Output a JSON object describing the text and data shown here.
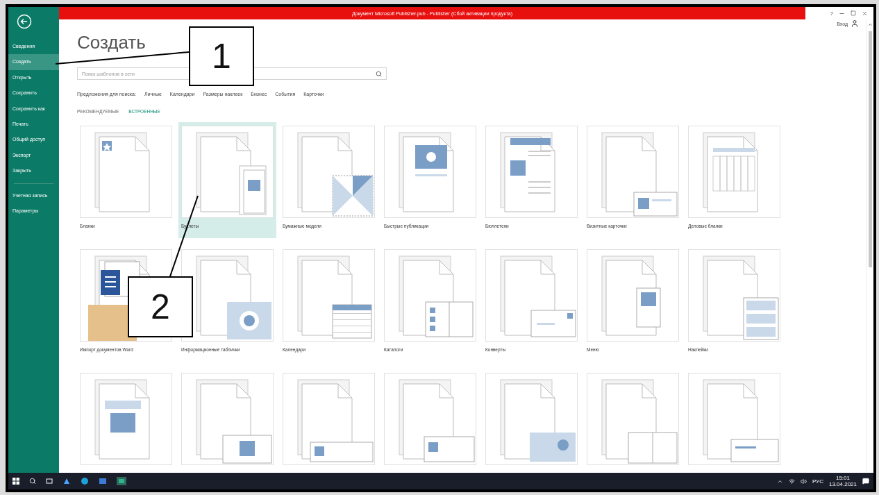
{
  "window": {
    "title": "Документ Microsoft Publisher.pub - Publisher (Сбой активации продукта)",
    "help": "?",
    "sign_in": "Вход"
  },
  "sidebar": {
    "items": [
      {
        "label": "Сведения",
        "selected": false
      },
      {
        "label": "Создать",
        "selected": true
      },
      {
        "label": "Открыть",
        "selected": false
      },
      {
        "label": "Сохранить",
        "selected": false
      },
      {
        "label": "Сохранить как",
        "selected": false
      },
      {
        "label": "Печать",
        "selected": false
      },
      {
        "label": "Общий доступ",
        "selected": false
      },
      {
        "label": "Экспорт",
        "selected": false
      },
      {
        "label": "Закрыть",
        "selected": false
      },
      {
        "label": "Учетная запись",
        "selected": false
      },
      {
        "label": "Параметры",
        "selected": false
      }
    ]
  },
  "page_title": "Создать",
  "search": {
    "placeholder": "Поиск шаблонов в сети"
  },
  "suggestions": {
    "label": "Предложения для поиска:",
    "items": [
      "Личные",
      "Календари",
      "Размеры наклеек",
      "Бизнес",
      "События",
      "Карточки"
    ]
  },
  "tabs": [
    {
      "label": "РЕКОМЕНДУЕМЫЕ",
      "selected": false
    },
    {
      "label": "ВСТРОЕННЫЕ",
      "selected": true
    }
  ],
  "templates": [
    {
      "label": "Бланки",
      "kind": "star",
      "selected": false
    },
    {
      "label": "Буклеты",
      "kind": "brochure",
      "selected": true
    },
    {
      "label": "Бумажные модели",
      "kind": "model",
      "selected": false
    },
    {
      "label": "Быстрые публикации",
      "kind": "quick",
      "selected": false
    },
    {
      "label": "Бюллетени",
      "kind": "newsletter",
      "selected": false
    },
    {
      "label": "Визитные карточки",
      "kind": "bizcard",
      "selected": false
    },
    {
      "label": "Деловые бланки",
      "kind": "form",
      "selected": false
    },
    {
      "label": "Импорт документов Word",
      "kind": "word",
      "selected": false
    },
    {
      "label": "Информационные таблички",
      "kind": "sign",
      "selected": false
    },
    {
      "label": "Календари",
      "kind": "calendar",
      "selected": false
    },
    {
      "label": "Каталоги",
      "kind": "catalog",
      "selected": false
    },
    {
      "label": "Конверты",
      "kind": "envelope",
      "selected": false
    },
    {
      "label": "Меню",
      "kind": "menu",
      "selected": false
    },
    {
      "label": "Наклейки",
      "kind": "labels",
      "selected": false
    },
    {
      "kind": "video",
      "selected": false
    },
    {
      "kind": "heart",
      "selected": false
    },
    {
      "kind": "banner",
      "selected": false
    },
    {
      "kind": "photo",
      "selected": false
    },
    {
      "kind": "circle",
      "selected": false
    },
    {
      "kind": "postcard",
      "selected": false
    },
    {
      "kind": "strip",
      "selected": false
    }
  ],
  "callouts": [
    {
      "label": "1"
    },
    {
      "label": "2"
    }
  ],
  "taskbar": {
    "language": "РУС",
    "time": "15:01",
    "date": "13.04.2021"
  }
}
